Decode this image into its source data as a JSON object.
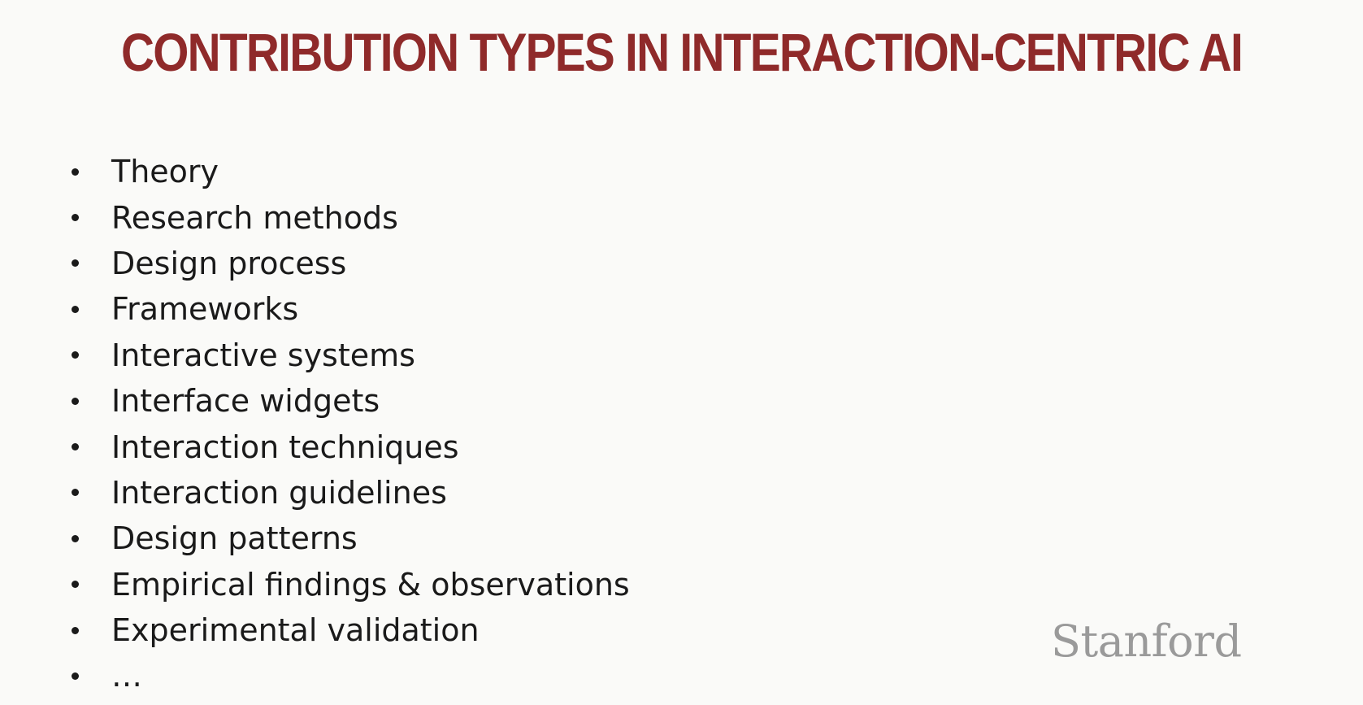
{
  "slide": {
    "title": "CONTRIBUTION TYPES IN INTERACTION-CENTRIC AI",
    "bullets": [
      "Theory",
      "Research methods",
      "Design process",
      "Frameworks",
      "Interactive systems",
      "Interface widgets",
      "Interaction techniques",
      "Interaction guidelines",
      "Design patterns",
      "Empirical findings & observations",
      "Experimental validation",
      "…"
    ],
    "logo": "Stanford"
  },
  "colors": {
    "background": "#fafaf8",
    "title": "#8f2a2a",
    "text": "#1a1a1a",
    "logo": "#9a9a9a"
  }
}
